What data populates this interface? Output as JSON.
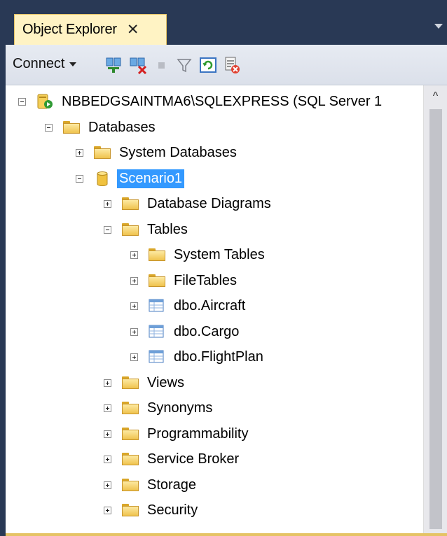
{
  "tab": {
    "title": "Object Explorer",
    "close": "✕"
  },
  "toolbar": {
    "connect_label": "Connect"
  },
  "tree": {
    "server": "NBBEDGSAINTMA6\\SQLEXPRESS (SQL Server 1",
    "databases": "Databases",
    "system_databases": "System Databases",
    "database": "Scenario1",
    "database_diagrams": "Database Diagrams",
    "tables": "Tables",
    "system_tables": "System Tables",
    "file_tables": "FileTables",
    "table_1": "dbo.Aircraft",
    "table_2": "dbo.Cargo",
    "table_3": "dbo.FlightPlan",
    "views": "Views",
    "synonyms": "Synonyms",
    "programmability": "Programmability",
    "service_broker": "Service Broker",
    "storage": "Storage",
    "security": "Security"
  },
  "scrollbar": {
    "up_arrow": "^"
  },
  "icons": {
    "server": "server-connected-icon",
    "folder": "folder-icon",
    "database": "database-cylinder-icon",
    "table": "table-grid-icon"
  },
  "colors": {
    "selection": "#3399ff",
    "tab_active": "#fff3c4",
    "chrome": "#293955"
  }
}
